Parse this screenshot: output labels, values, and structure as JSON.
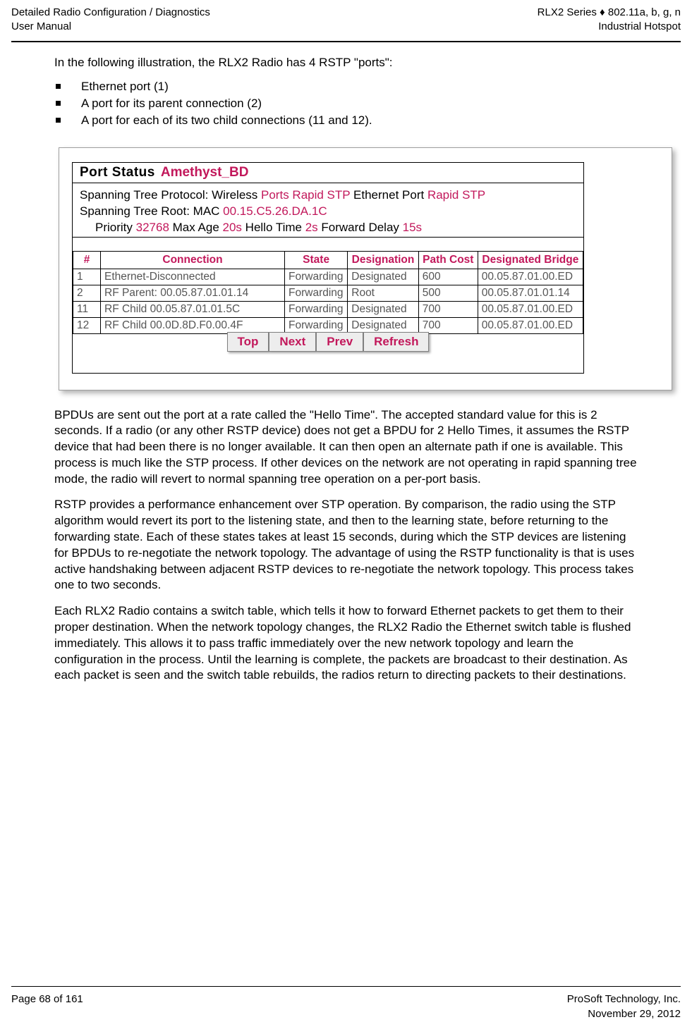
{
  "header": {
    "left_line1": "Detailed Radio Configuration / Diagnostics",
    "left_line2": "User Manual",
    "right_line1": "RLX2 Series ♦ 802.11a, b, g, n",
    "right_line2": "Industrial Hotspot"
  },
  "body": {
    "intro": "In the following illustration, the RLX2 Radio has 4 RSTP \"ports\":",
    "bullets": [
      "Ethernet port (1)",
      "A port for its parent connection (2)",
      "A port for each of its two child connections (11 and 12)."
    ],
    "paragraphs": [
      "BPDUs are sent out the port at a rate called the \"Hello Time\". The accepted standard value for this is 2 seconds. If a radio (or any other RSTP device) does not get a BPDU for 2 Hello Times, it assumes the RSTP device that had been there is no longer available. It can then open an alternate path if one is available. This process is much like the STP process. If other devices on the network are not operating in rapid spanning tree mode, the radio will revert to normal spanning tree operation on a per-port basis.",
      "RSTP provides a performance enhancement over STP operation. By comparison, the radio using the STP algorithm would revert its port to the listening state, and then to the learning state, before returning to the forwarding state. Each of these states takes at least 15 seconds, during which the STP devices are listening for BPDUs to re-negotiate the network topology. The advantage of using the RSTP functionality is that is uses active handshaking between adjacent RSTP devices to re-negotiate the network topology. This process takes one to two seconds.",
      "Each RLX2 Radio contains a switch table, which tells it how to forward Ethernet packets to get them to their proper destination. When the network topology changes, the RLX2 Radio the Ethernet switch table is flushed immediately. This allows it to pass traffic immediately over the new network topology and learn the configuration in the process. Until the learning is complete, the packets are broadcast to their destination. As each packet is seen and the switch table rebuilds, the radios return to directing packets to their destinations."
    ]
  },
  "screenshot": {
    "title_label": "Port Status",
    "title_value": "Amethyst_BD",
    "line1_label": "Spanning Tree Protocol: Wireless ",
    "line1_value1": "Ports Rapid STP",
    "line1_label2": " Ethernet Port ",
    "line1_value2": "Rapid STP",
    "line2_label": "Spanning Tree Root: MAC ",
    "line2_value": "00.15.C5.26.DA.1C",
    "line3_label": "Priority ",
    "line3_value1": "32768",
    "line3_label2": " Max Age ",
    "line3_value2": "20s",
    "line3_label3": " Hello Time ",
    "line3_value3": "2s",
    "line3_label4": " Forward Delay ",
    "line3_value4": "15s",
    "columns": [
      "#",
      "Connection",
      "State",
      "Designation",
      "Path Cost",
      "Designated Bridge"
    ],
    "rows": [
      [
        "1",
        "Ethernet-Disconnected",
        "Forwarding",
        "Designated",
        "600",
        "00.05.87.01.00.ED"
      ],
      [
        "2",
        "RF Parent: 00.05.87.01.01.14",
        "Forwarding",
        "Root",
        "500",
        "00.05.87.01.01.14"
      ],
      [
        "11",
        "RF Child 00.05.87.01.01.5C",
        "Forwarding",
        "Designated",
        "700",
        "00.05.87.01.00.ED"
      ],
      [
        "12",
        "RF Child 00.0D.8D.F0.00.4F",
        "Forwarding",
        "Designated",
        "700",
        "00.05.87.01.00.ED"
      ]
    ],
    "buttons": [
      "Top",
      "Next",
      "Prev",
      "Refresh"
    ],
    "accent_color": "#c2185b"
  },
  "footer": {
    "left": "Page 68 of 161",
    "right_line1": "ProSoft Technology, Inc.",
    "right_line2": "November 29, 2012"
  }
}
